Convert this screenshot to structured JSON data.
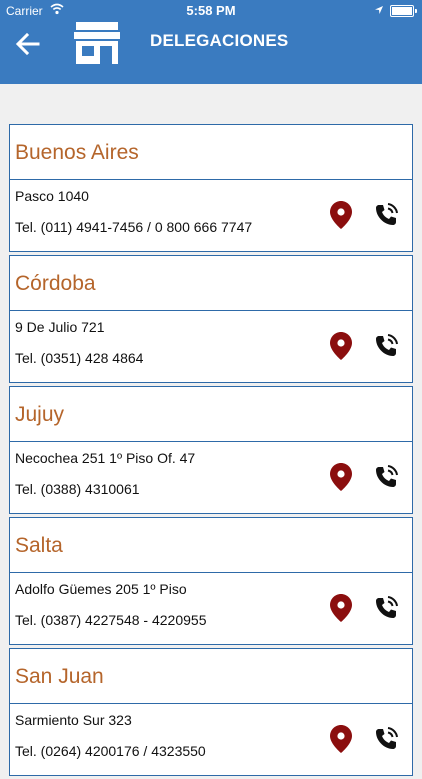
{
  "status_bar": {
    "carrier": "Carrier",
    "time": "5:58 PM"
  },
  "header": {
    "title": "DELEGACIONES",
    "back_icon": "arrow-left-icon",
    "title_icon": "storefront-icon"
  },
  "colors": {
    "header_bg": "#3a7bc0",
    "card_title": "#b5652b",
    "card_border": "#2e6aa8",
    "pin": "#8b0e0e"
  },
  "delegations": [
    {
      "name": "Buenos Aires",
      "address": "Pasco 1040",
      "phone": "Tel. (011) 4941-7456 / 0 800 666 7747"
    },
    {
      "name": "Córdoba",
      "address": "9 De Julio 721",
      "phone": "Tel. (0351) 428 4864"
    },
    {
      "name": "Jujuy",
      "address": "Necochea 251 1º Piso Of. 47",
      "phone": "Tel. (0388) 4310061"
    },
    {
      "name": "Salta",
      "address": "Adolfo Güemes 205 1º Piso",
      "phone": "Tel. (0387) 4227548 - 4220955"
    },
    {
      "name": "San Juan",
      "address": "Sarmiento Sur 323",
      "phone": "Tel. (0264) 4200176 / 4323550"
    }
  ]
}
